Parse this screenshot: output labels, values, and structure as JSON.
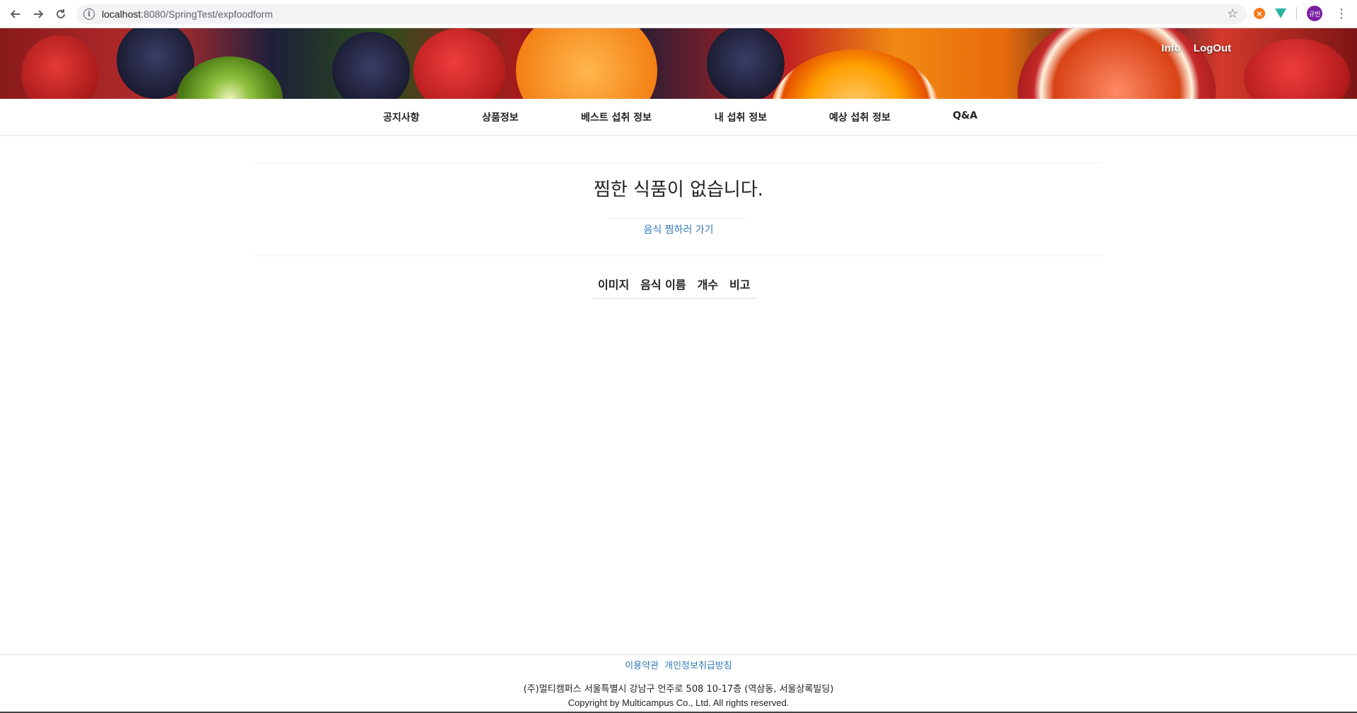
{
  "browser": {
    "url_host": "localhost",
    "url_rest": ":8080/SpringTest/expfoodform",
    "profile_initials": "규빈"
  },
  "header": {
    "links": [
      {
        "label": "Info"
      },
      {
        "label": "LogOut"
      }
    ]
  },
  "nav": {
    "items": [
      {
        "label": "공지사항"
      },
      {
        "label": "상품정보"
      },
      {
        "label": "베스트 섭취 정보"
      },
      {
        "label": "내 섭취 정보"
      },
      {
        "label": "예상 섭취 정보"
      },
      {
        "label": "Q&A"
      }
    ]
  },
  "main": {
    "empty_message": "찜한 식품이 없습니다.",
    "go_link": "음식 찜하러 가기",
    "table_headers": [
      "이미지",
      "음식 이름",
      "개수",
      "비고"
    ]
  },
  "footer": {
    "terms_link": "이용약관",
    "privacy_link": "개인정보취급방침",
    "address": "(주)멀티캠퍼스 서울특별시 강남구 언주로 508 10-17층 (역삼동, 서울상록빌딩)",
    "copyright": "Copyright by Multicampus Co., Ltd. All rights reserved."
  }
}
